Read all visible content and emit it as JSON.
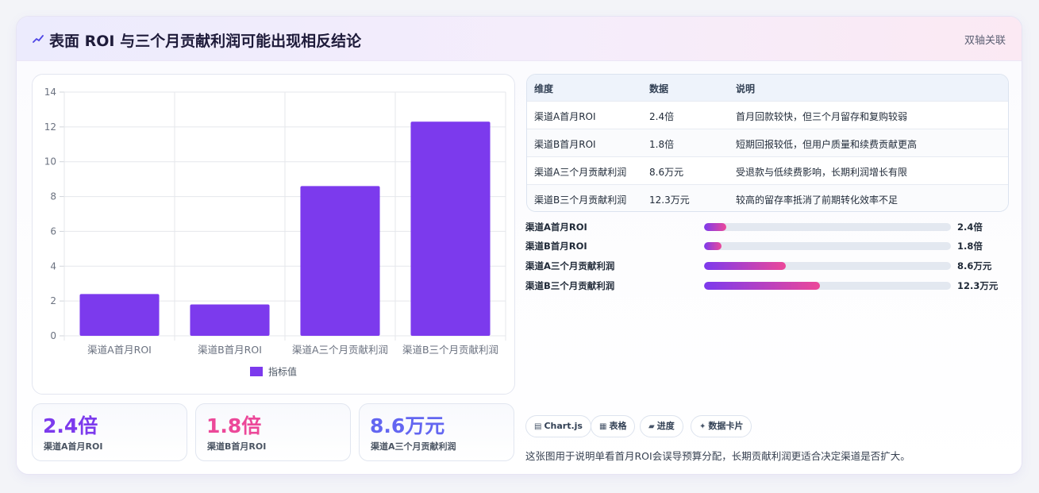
{
  "header": {
    "title": "表面 ROI 与三个月贡献利润可能出现相反结论",
    "tag": "双轴关联"
  },
  "chart_data": {
    "type": "bar",
    "categories": [
      "渠道A首月ROI",
      "渠道B首月ROI",
      "渠道A三个月贡献利润",
      "渠道B三个月贡献利润"
    ],
    "series": [
      {
        "name": "指标值",
        "values": [
          2.4,
          1.8,
          8.6,
          12.3
        ],
        "color": "#7c3aed"
      }
    ],
    "yticks": [
      "0",
      "2",
      "4",
      "6",
      "8",
      "10",
      "12",
      "14"
    ],
    "ylim": [
      0,
      14
    ],
    "grid": true,
    "legend": "bottom"
  },
  "stats": [
    {
      "value": "2.4倍",
      "label": "渠道A首月ROI",
      "color": "#7c3aed"
    },
    {
      "value": "1.8倍",
      "label": "渠道B首月ROI",
      "color": "#ec4899"
    },
    {
      "value": "8.6万元",
      "label": "渠道A三个月贡献利润",
      "color": "#6366f1"
    }
  ],
  "table": {
    "headers": [
      "维度",
      "数据",
      "说明"
    ],
    "rows": [
      [
        "渠道A首月ROI",
        "2.4倍",
        "首月回款较快，但三个月留存和复购较弱"
      ],
      [
        "渠道B首月ROI",
        "1.8倍",
        "短期回报较低，但用户质量和续费贡献更高"
      ],
      [
        "渠道A三个月贡献利润",
        "8.6万元",
        "受退款与低续费影响，长期利润增长有限"
      ],
      [
        "渠道B三个月贡献利润",
        "12.3万元",
        "较高的留存率抵消了前期转化效率不足"
      ]
    ]
  },
  "progress": [
    {
      "label": "渠道A首月ROI",
      "value": "2.4倍",
      "fraction": 0.09
    },
    {
      "label": "渠道B首月ROI",
      "value": "1.8倍",
      "fraction": 0.07
    },
    {
      "label": "渠道A三个月贡献利润",
      "value": "8.6万元",
      "fraction": 0.33
    },
    {
      "label": "渠道B三个月贡献利润",
      "value": "12.3万元",
      "fraction": 0.47
    }
  ],
  "chips": [
    {
      "icon": "chart-icon",
      "label": "Chart.js"
    },
    {
      "icon": "table-icon",
      "label": "表格"
    },
    {
      "icon": "progress-icon",
      "label": "进度"
    },
    {
      "icon": "sparkle-icon",
      "label": "数据卡片"
    }
  ],
  "note": "这张图用于说明单看首月ROI会误导预算分配，长期贡献利润更适合决定渠道是否扩大。"
}
